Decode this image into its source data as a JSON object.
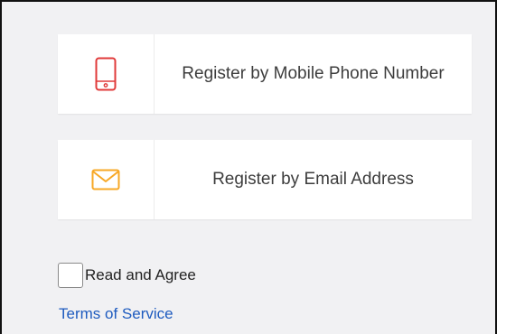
{
  "options": [
    {
      "icon": "mobile-phone-icon",
      "label": "Register by Mobile Phone Number",
      "icon_color": "#e03a3a"
    },
    {
      "icon": "envelope-icon",
      "label": "Register by Email Address",
      "icon_color": "#f7a826"
    }
  ],
  "agreement": {
    "checkbox_checked": false,
    "label": "Read and Agree",
    "link_text": "Terms of Service",
    "link_color": "#1e5bbf"
  },
  "colors": {
    "background": "#f1f1f3",
    "card": "#ffffff",
    "text": "#3d3d3d"
  }
}
